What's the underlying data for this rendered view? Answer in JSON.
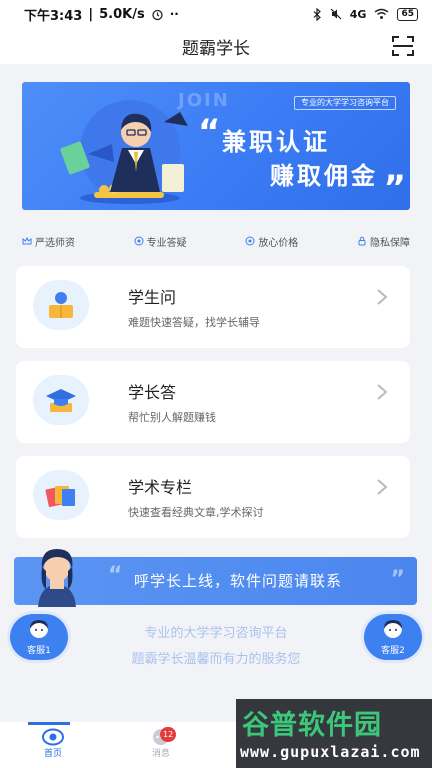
{
  "status_bar": {
    "time": "下午3:43",
    "network_speed": "5.0K/s",
    "signal": "4G",
    "battery": "65"
  },
  "header": {
    "title": "题霸学长",
    "scan_icon": "scan-icon"
  },
  "banner": {
    "watermark_text": "JOIN",
    "tag": "专业的大学学习咨询平台",
    "line1": "兼职认证",
    "line2": "赚取佣金",
    "quote_open": "“",
    "quote_close": "”",
    "page_count": 4,
    "active_page": 0
  },
  "features": [
    {
      "label": "严选师资",
      "icon": "crown-icon"
    },
    {
      "label": "专业答疑",
      "icon": "eye-icon"
    },
    {
      "label": "放心价格",
      "icon": "eye-icon"
    },
    {
      "label": "隐私保障",
      "icon": "lock-icon"
    }
  ],
  "cards": [
    {
      "title": "学生问",
      "subtitle": "难题快速答疑，找学长辅导",
      "icon": "student-icon"
    },
    {
      "title": "学长答",
      "subtitle": "帮忙别人解题赚钱",
      "icon": "graduation-cap-icon"
    },
    {
      "title": "学术专栏",
      "subtitle": "快速查看经典文章,学术探讨",
      "icon": "books-icon"
    }
  ],
  "notice": {
    "text": "呼学长上线，软件问题请联系",
    "quote_open": "“",
    "quote_close": "”"
  },
  "taglines": {
    "line1": "专业的大学学习咨询平台",
    "line2": "题霸学长温馨而有力的服务您"
  },
  "customer_service": {
    "left_label": "客服1",
    "right_label": "客服2"
  },
  "tab_bar": {
    "home_label": "首页",
    "messages_label": "消息",
    "messages_badge": "12"
  },
  "watermark": {
    "brand": "谷普软件园",
    "url": "www.gupuxlazai.com"
  },
  "colors": {
    "accent": "#2c6fe4",
    "banner": "#3b7cf5",
    "badge": "#e43b3b",
    "watermark_green": "#3cc87a"
  }
}
